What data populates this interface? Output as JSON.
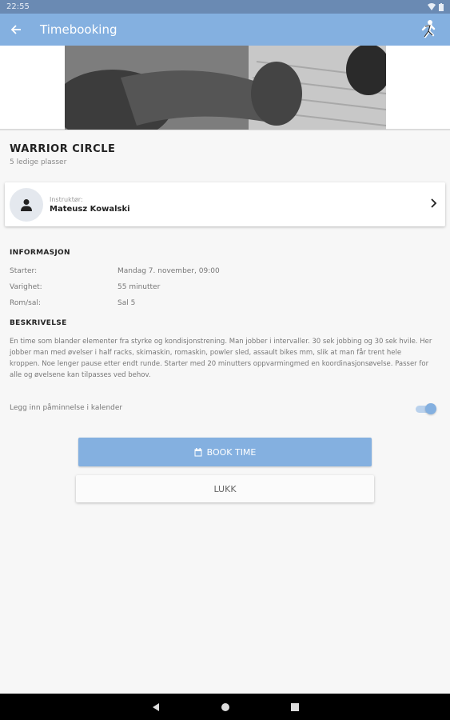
{
  "status_bar": {
    "time": "22:55"
  },
  "app_bar": {
    "title": "Timebooking",
    "back_icon": "arrow-left-icon",
    "logo": "runner-logo"
  },
  "class": {
    "title": "WARRIOR CIRCLE",
    "spots": "5 ledige plasser"
  },
  "instructor": {
    "label": "Instruktør:",
    "name": "Mateusz Kowalski"
  },
  "information": {
    "heading": "INFORMASJON",
    "rows": [
      {
        "label": "Starter:",
        "value": "Mandag 7. november, 09:00"
      },
      {
        "label": "Varighet:",
        "value": "55 minutter"
      },
      {
        "label": "Rom/sal:",
        "value": "Sal 5"
      }
    ]
  },
  "description": {
    "heading": "BESKRIVELSE",
    "text": "En time som blander elementer fra styrke og kondisjonstrening. Man jobber i intervaller. 30 sek jobbing og 30 sek hvile. Her jobber man med øvelser i half racks, skimaskin, romaskin, powler sled, assault bikes mm, slik at man får trent hele kroppen. Noe lenger pause etter endt runde. Starter med 20 minutters oppvarmingmed en koordinasjonsøvelse. Passer for alle og øvelsene kan tilpasses ved behov."
  },
  "reminder": {
    "label": "Legg inn påminnelse i kalender",
    "enabled": true
  },
  "buttons": {
    "book": "BOOK TIME",
    "close": "LUKK"
  },
  "colors": {
    "primary": "#84b0e0",
    "status_bar": "#6a8ab3"
  }
}
